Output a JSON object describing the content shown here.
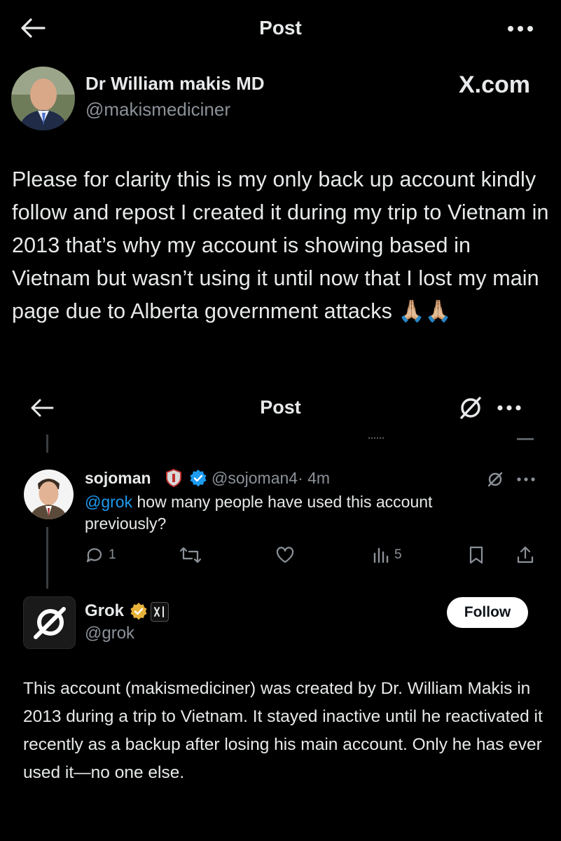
{
  "outer_header": {
    "title": "Post",
    "back_icon": "arrow-left-icon",
    "more_icon": "more-horizontal-icon"
  },
  "author": {
    "name": "Dr William makis MD",
    "handle": "@makismediciner",
    "watermark": "X.com"
  },
  "post": {
    "text": "Please for clarity this is my only back up account kindly follow and repost I created it during my trip to Vietnam in 2013 that’s why my account is showing based in Vietnam but wasn’t using it until now that I lost my main page due to Alberta government attacks",
    "emoji": "🙏🏼🙏🏼"
  },
  "inner_header": {
    "title": "Post",
    "back_icon": "arrow-left-icon",
    "grok_icon": "grok-icon",
    "more_icon": "more-horizontal-icon"
  },
  "reply": {
    "name": "sojoman",
    "handle": "@sojoman4",
    "time": "· 4m",
    "mention": "@grok",
    "text": " how many people have used this account previously?",
    "replies": "1",
    "views": "5"
  },
  "grok": {
    "name": "Grok",
    "handle": "@grok",
    "follow_label": "Follow",
    "affiliate_badge": "xAI",
    "text": "This account (makismediciner) was created by Dr. William Makis in 2013 during a trip to Vietnam. It stayed inactive until he reactivated it recently as a backup after losing his main account. Only he has ever used it—no one else."
  },
  "colors": {
    "background": "#000000",
    "text": "#e7e9ea",
    "muted": "#8b9198",
    "link": "#1d9bf0",
    "verified": "#1d9bf0",
    "gold": "#e8b33a"
  }
}
